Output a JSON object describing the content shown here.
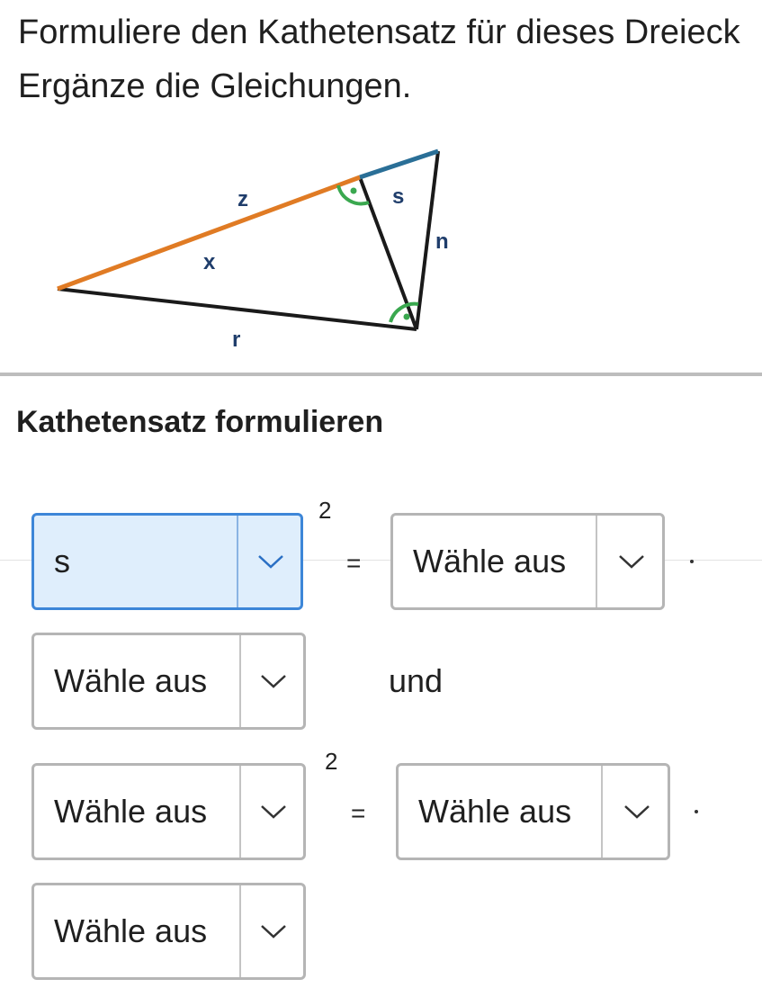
{
  "instructions": {
    "line1": "Formuliere den Kathetensatz für dieses Dreieck",
    "line2": "Ergänze die Gleichungen."
  },
  "diagram": {
    "labels": {
      "z": "z",
      "s": "s",
      "n": "n",
      "x": "x",
      "r": "r"
    },
    "colors": {
      "orange_side": "#e07b24",
      "blue_side": "#2a6f97",
      "black_side": "#1a1a1a",
      "angle_marker": "#3aa84f",
      "label_color": "#1f3d6b"
    }
  },
  "section_title": "Kathetensatz formulieren",
  "equation1": {
    "left_value": "s",
    "exponent": "2",
    "equals": "=",
    "right_value": "Wähle aus",
    "times": "·",
    "second_factor": "Wähle aus"
  },
  "connector": "und",
  "equation2": {
    "left_value": "Wähle aus",
    "exponent": "2",
    "equals": "=",
    "right_value": "Wähle aus",
    "times": "·",
    "second_factor": "Wähle aus"
  }
}
